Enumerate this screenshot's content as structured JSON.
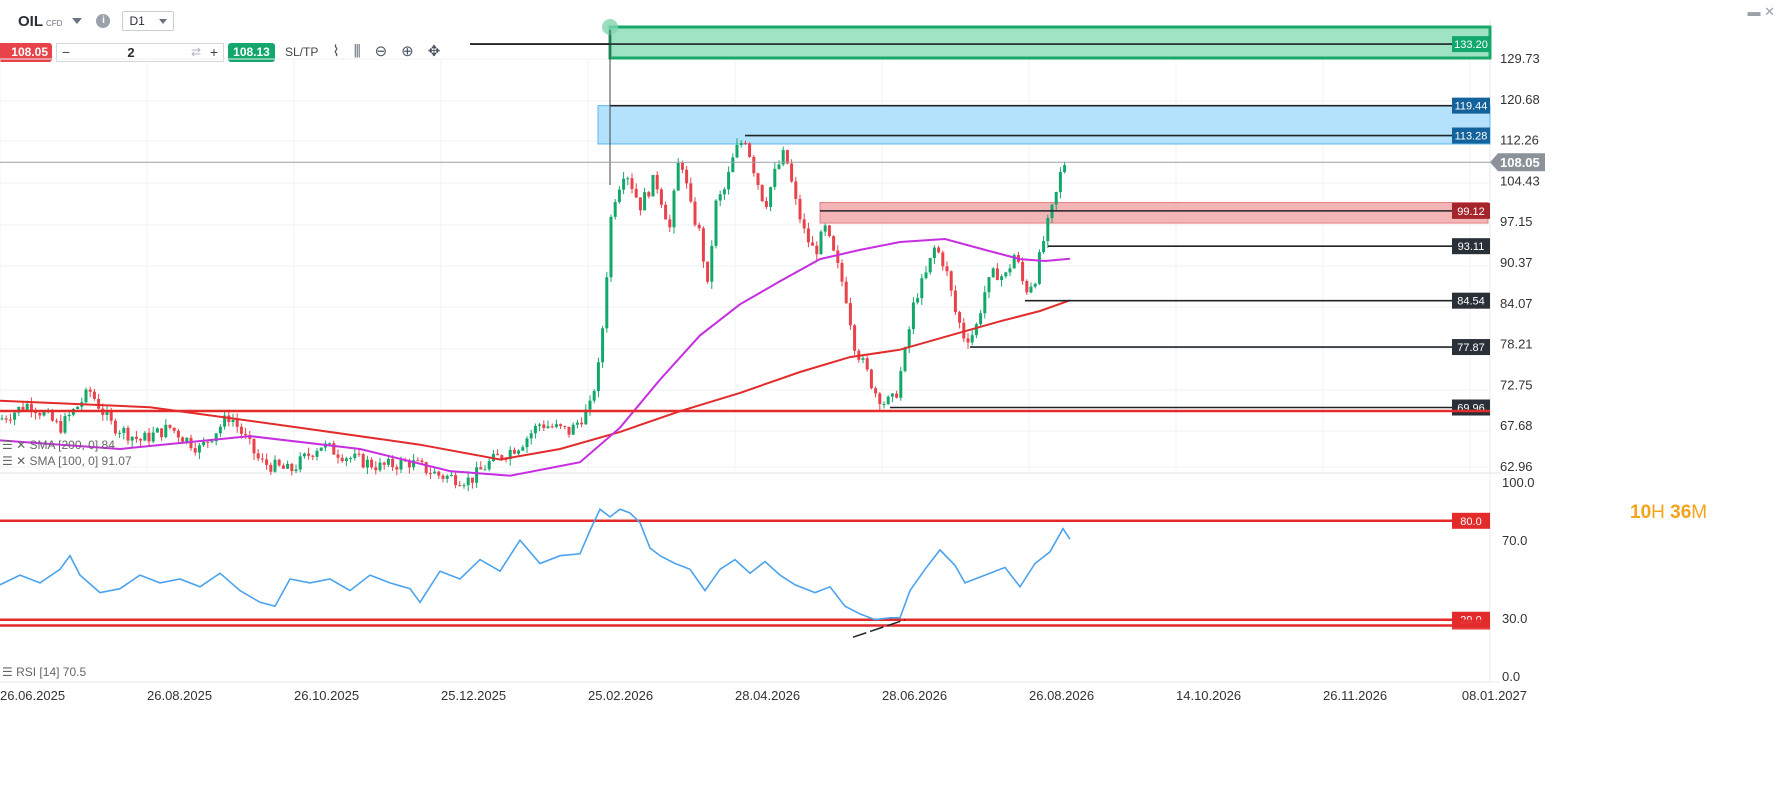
{
  "header": {
    "symbol": "OIL",
    "symbol_type": "CFD",
    "timeframe": "D1",
    "sell_price": "108.05",
    "quantity": "2",
    "buy_price": "108.13",
    "sltp_label": "SL/TP",
    "minus": "−",
    "plus": "+"
  },
  "timer": {
    "hours": "10",
    "h_unit": "H",
    "minutes": "36",
    "m_unit": "M"
  },
  "indicators": {
    "sma200": "SMA [200, 0] 84",
    "sma100": "SMA [100, 0] 91.07",
    "rsi": "RSI [14] 70.5"
  },
  "colors": {
    "bull": "#13a86b",
    "bear": "#e8424a",
    "sma200": "#e32b2b",
    "sma100": "#c62ee0",
    "rsi": "#4ba3ee",
    "zone_green": "#9fe3c2",
    "zone_blue": "#b4e1fb",
    "zone_red": "#f3a9ab",
    "level_dark": "#2a3038"
  },
  "chart_data": {
    "type": "candlestick",
    "x_ticks": [
      "26.06.2025",
      "26.08.2025",
      "26.10.2025",
      "25.12.2025",
      "25.02.2026",
      "28.04.2026",
      "28.06.2026",
      "26.08.2026",
      "14.10.2026",
      "26.11.2026",
      "08.01.2027"
    ],
    "price_ticks": [
      129.73,
      120.68,
      112.26,
      104.43,
      97.15,
      90.37,
      84.07,
      78.21,
      72.75,
      67.68,
      62.96
    ],
    "current_price": 108.05,
    "levels": [
      {
        "label": "133.20",
        "value": 133.2,
        "style": "green"
      },
      {
        "label": "119.44",
        "value": 119.44,
        "style": "blue"
      },
      {
        "label": "113.28",
        "value": 113.28,
        "style": "blue"
      },
      {
        "label": "99.12",
        "value": 99.12,
        "style": "red"
      },
      {
        "label": "93.11",
        "value": 93.11,
        "style": "dark"
      },
      {
        "label": "84.54",
        "value": 84.54,
        "style": "dark"
      },
      {
        "label": "77.87",
        "value": 77.87,
        "style": "dark"
      },
      {
        "label": "69.96",
        "value": 69.96,
        "style": "dark"
      }
    ],
    "zones": [
      {
        "name": "green-zone",
        "from": 130.0,
        "to": 134.5
      },
      {
        "name": "blue-zone",
        "from": 111.6,
        "to": 119.44
      },
      {
        "name": "red-zone",
        "from": 97.0,
        "to": 100.6
      }
    ],
    "price_path": [
      [
        0,
        68.5
      ],
      [
        30,
        70.5
      ],
      [
        60,
        67.5
      ],
      [
        90,
        72.0
      ],
      [
        110,
        68.0
      ],
      [
        140,
        66.0
      ],
      [
        170,
        67.5
      ],
      [
        200,
        65.0
      ],
      [
        230,
        69.0
      ],
      [
        260,
        63.5
      ],
      [
        290,
        62.5
      ],
      [
        320,
        65.5
      ],
      [
        350,
        64.0
      ],
      [
        380,
        63.0
      ],
      [
        410,
        63.5
      ],
      [
        440,
        62.0
      ],
      [
        470,
        61.5
      ],
      [
        490,
        63.5
      ],
      [
        520,
        65.5
      ],
      [
        540,
        68.0
      ],
      [
        570,
        67.0
      ],
      [
        590,
        70.0
      ],
      [
        600,
        76.0
      ],
      [
        605,
        85.0
      ],
      [
        612,
        100.0
      ],
      [
        625,
        107.0
      ],
      [
        640,
        100.0
      ],
      [
        655,
        105.0
      ],
      [
        670,
        96.0
      ],
      [
        680,
        110.0
      ],
      [
        690,
        100.0
      ],
      [
        700,
        95.0
      ],
      [
        708,
        86.0
      ],
      [
        715,
        100.0
      ],
      [
        725,
        103.0
      ],
      [
        735,
        110.0
      ],
      [
        745,
        113.0
      ],
      [
        755,
        106.0
      ],
      [
        765,
        100.0
      ],
      [
        775,
        106.0
      ],
      [
        785,
        110.0
      ],
      [
        795,
        101.0
      ],
      [
        805,
        95.0
      ],
      [
        815,
        92.0
      ],
      [
        825,
        96.0
      ],
      [
        835,
        91.0
      ],
      [
        845,
        86.0
      ],
      [
        855,
        78.0
      ],
      [
        865,
        75.0
      ],
      [
        875,
        72.0
      ],
      [
        885,
        70.5
      ],
      [
        895,
        71.0
      ],
      [
        905,
        77.0
      ],
      [
        915,
        85.0
      ],
      [
        925,
        88.0
      ],
      [
        935,
        93.0
      ],
      [
        945,
        90.0
      ],
      [
        955,
        83.0
      ],
      [
        965,
        79.0
      ],
      [
        975,
        80.0
      ],
      [
        985,
        86.0
      ],
      [
        995,
        89.0
      ],
      [
        1005,
        88.0
      ],
      [
        1015,
        92.0
      ],
      [
        1025,
        86.0
      ],
      [
        1035,
        88.0
      ],
      [
        1045,
        95.0
      ],
      [
        1055,
        101.0
      ],
      [
        1063,
        108.0
      ],
      [
        1070,
        107.5
      ]
    ],
    "sma200_path": [
      [
        0,
        70.8
      ],
      [
        150,
        70.0
      ],
      [
        300,
        67.5
      ],
      [
        420,
        65.5
      ],
      [
        500,
        63.8
      ],
      [
        560,
        65.0
      ],
      [
        620,
        67.0
      ],
      [
        680,
        69.5
      ],
      [
        740,
        71.8
      ],
      [
        800,
        74.5
      ],
      [
        850,
        76.5
      ],
      [
        900,
        77.5
      ],
      [
        950,
        79.5
      ],
      [
        1000,
        81.5
      ],
      [
        1040,
        83.0
      ],
      [
        1070,
        84.6
      ]
    ],
    "sma100_path": [
      [
        0,
        66.0
      ],
      [
        120,
        65.0
      ],
      [
        250,
        66.5
      ],
      [
        360,
        65.0
      ],
      [
        450,
        62.5
      ],
      [
        510,
        62.0
      ],
      [
        580,
        63.5
      ],
      [
        620,
        67.5
      ],
      [
        660,
        73.5
      ],
      [
        700,
        79.5
      ],
      [
        740,
        84.0
      ],
      [
        780,
        87.5
      ],
      [
        820,
        91.0
      ],
      [
        860,
        92.5
      ],
      [
        900,
        93.8
      ],
      [
        945,
        94.3
      ],
      [
        985,
        92.5
      ],
      [
        1020,
        91.0
      ],
      [
        1045,
        90.7
      ],
      [
        1070,
        91.07
      ]
    ],
    "rsi_ticks": [
      100.0,
      70.0,
      30.0,
      0.0
    ],
    "rsi_levels": [
      {
        "label": "80.0",
        "value": 80.0
      },
      {
        "label": "29.0",
        "value": 29.0
      }
    ],
    "rsi_path": [
      [
        0,
        47
      ],
      [
        20,
        52
      ],
      [
        40,
        48
      ],
      [
        60,
        55
      ],
      [
        70,
        62
      ],
      [
        80,
        52
      ],
      [
        100,
        43
      ],
      [
        120,
        45
      ],
      [
        140,
        52
      ],
      [
        160,
        48
      ],
      [
        180,
        50
      ],
      [
        200,
        46
      ],
      [
        220,
        53
      ],
      [
        240,
        44
      ],
      [
        260,
        38
      ],
      [
        275,
        36
      ],
      [
        290,
        50
      ],
      [
        310,
        48
      ],
      [
        330,
        50
      ],
      [
        350,
        44
      ],
      [
        370,
        52
      ],
      [
        390,
        48
      ],
      [
        410,
        45
      ],
      [
        420,
        38
      ],
      [
        440,
        54
      ],
      [
        460,
        50
      ],
      [
        480,
        60
      ],
      [
        500,
        54
      ],
      [
        520,
        70
      ],
      [
        540,
        58
      ],
      [
        560,
        62
      ],
      [
        580,
        63
      ],
      [
        590,
        75
      ],
      [
        600,
        86
      ],
      [
        610,
        82
      ],
      [
        620,
        86
      ],
      [
        630,
        84
      ],
      [
        640,
        79
      ],
      [
        650,
        66
      ],
      [
        660,
        62
      ],
      [
        675,
        58
      ],
      [
        690,
        55
      ],
      [
        705,
        44
      ],
      [
        720,
        55
      ],
      [
        735,
        60
      ],
      [
        750,
        53
      ],
      [
        765,
        59
      ],
      [
        780,
        52
      ],
      [
        795,
        47
      ],
      [
        815,
        43
      ],
      [
        830,
        46
      ],
      [
        845,
        36
      ],
      [
        860,
        32
      ],
      [
        875,
        29
      ],
      [
        890,
        30
      ],
      [
        900,
        30
      ],
      [
        910,
        44
      ],
      [
        925,
        55
      ],
      [
        940,
        65
      ],
      [
        955,
        57
      ],
      [
        965,
        48
      ],
      [
        975,
        50
      ],
      [
        990,
        53
      ],
      [
        1005,
        56
      ],
      [
        1020,
        46
      ],
      [
        1035,
        58
      ],
      [
        1050,
        64
      ],
      [
        1063,
        76
      ],
      [
        1070,
        70.5
      ]
    ]
  }
}
